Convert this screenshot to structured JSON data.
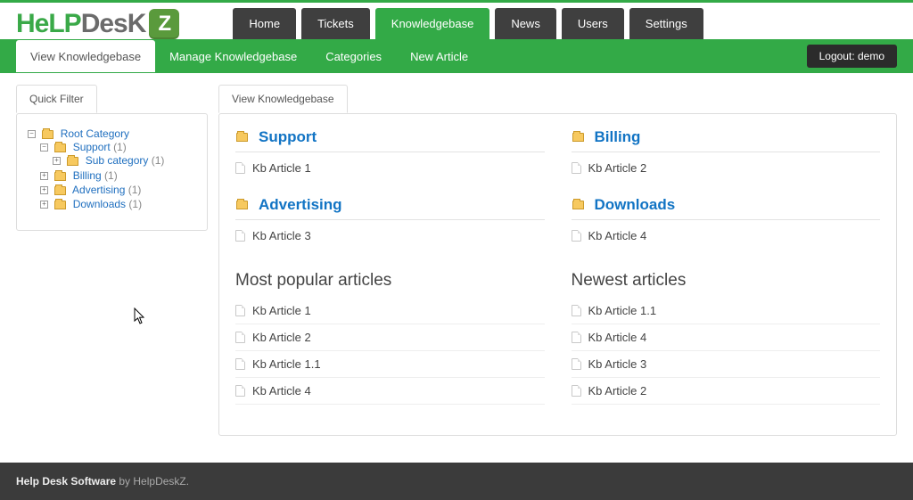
{
  "brand": {
    "part1": "HeLP",
    "part2": "DesK",
    "badge": "Z"
  },
  "nav": {
    "items": [
      {
        "label": "Home"
      },
      {
        "label": "Tickets"
      },
      {
        "label": "Knowledgebase",
        "active": true
      },
      {
        "label": "News"
      },
      {
        "label": "Users"
      },
      {
        "label": "Settings"
      }
    ]
  },
  "subnav": {
    "items": [
      {
        "label": "View Knowledgebase",
        "active": true
      },
      {
        "label": "Manage Knowledgebase"
      },
      {
        "label": "Categories"
      },
      {
        "label": "New Article"
      }
    ],
    "logout": "Logout: demo"
  },
  "sidebar": {
    "tab": "Quick Filter",
    "tree": {
      "root": {
        "label": "Root Category"
      },
      "support": {
        "label": "Support",
        "count": "(1)"
      },
      "subcategory": {
        "label": "Sub category",
        "count": "(1)"
      },
      "billing": {
        "label": "Billing",
        "count": "(1)"
      },
      "advertising": {
        "label": "Advertising",
        "count": "(1)"
      },
      "downloads": {
        "label": "Downloads",
        "count": "(1)"
      }
    }
  },
  "main": {
    "tab": "View Knowledgebase",
    "cats": {
      "support": {
        "title": "Support",
        "article": "Kb Article 1"
      },
      "billing": {
        "title": "Billing",
        "article": "Kb Article 2"
      },
      "advertising": {
        "title": "Advertising",
        "article": "Kb Article 3"
      },
      "downloads": {
        "title": "Downloads",
        "article": "Kb Article 4"
      }
    },
    "popular": {
      "title": "Most popular articles",
      "items": [
        "Kb Article 1",
        "Kb Article 2",
        "Kb Article 1.1",
        "Kb Article 4"
      ]
    },
    "newest": {
      "title": "Newest articles",
      "items": [
        "Kb Article 1.1",
        "Kb Article 4",
        "Kb Article 3",
        "Kb Article 2"
      ]
    }
  },
  "footer": {
    "bold": "Help Desk Software",
    "rest": " by HelpDeskZ."
  }
}
